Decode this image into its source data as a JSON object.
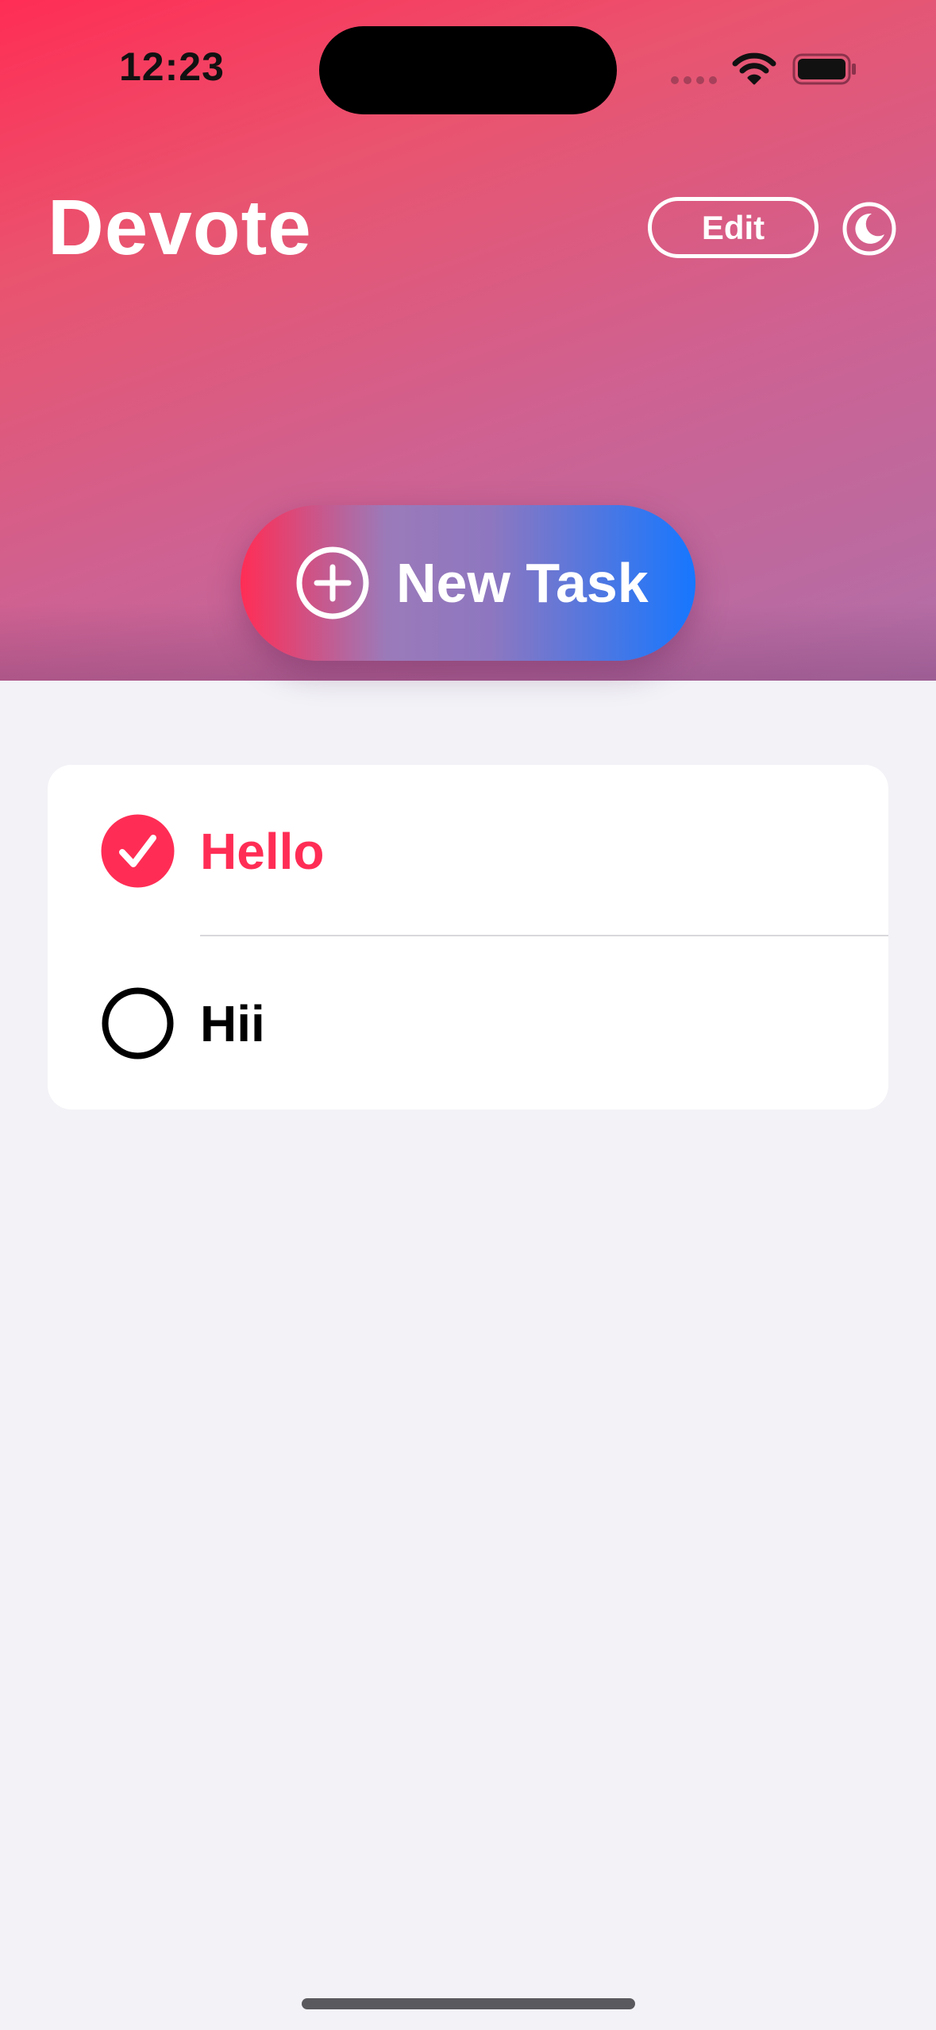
{
  "status_bar": {
    "time": "12:23",
    "icons": [
      "signal-dots",
      "wifi-icon",
      "battery-icon"
    ]
  },
  "header": {
    "title": "Devote",
    "edit_label": "Edit",
    "appearance_icon": "moon-icon",
    "gradient_colors": [
      "#ff2d55",
      "#cd6293",
      "#b06fa8"
    ]
  },
  "new_task": {
    "label": "New Task",
    "icon": "plus-circle-icon",
    "gradient_colors": [
      "#ff2d55",
      "#9b7ab9",
      "#1677ff"
    ]
  },
  "tasks": [
    {
      "label": "Hello",
      "completed": true,
      "color": "#ff2d55"
    },
    {
      "label": "Hii",
      "completed": false,
      "color": "#000000"
    }
  ]
}
